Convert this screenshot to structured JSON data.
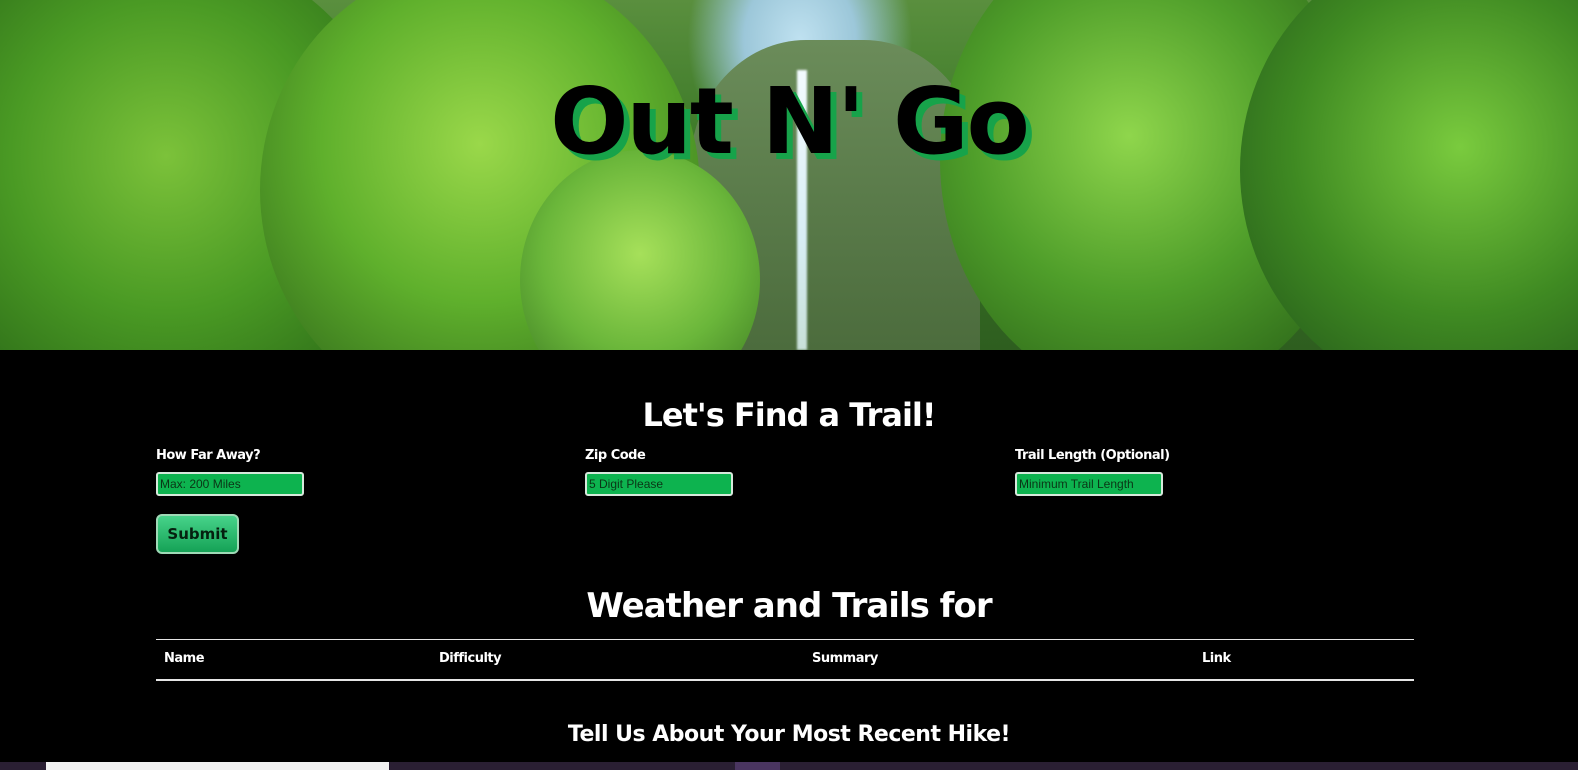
{
  "hero": {
    "title": "Out N' Go"
  },
  "search": {
    "heading": "Let's Find a Trail!",
    "distance": {
      "label": "How Far Away?",
      "placeholder": "Max: 200 Miles",
      "value": ""
    },
    "zip": {
      "label": "Zip Code",
      "placeholder": "5 Digit Please",
      "value": ""
    },
    "length": {
      "label": "Trail Length (Optional)",
      "placeholder": "Minimum Trail Length",
      "value": ""
    },
    "submit_label": "Submit"
  },
  "results": {
    "heading": "Weather and Trails for",
    "columns": [
      "Name",
      "Difficulty",
      "Summary",
      "Link"
    ]
  },
  "recent": {
    "heading": "Tell Us About Your Most Recent Hike!"
  },
  "colors": {
    "accent_green": "#0db34f",
    "background": "#000000"
  }
}
